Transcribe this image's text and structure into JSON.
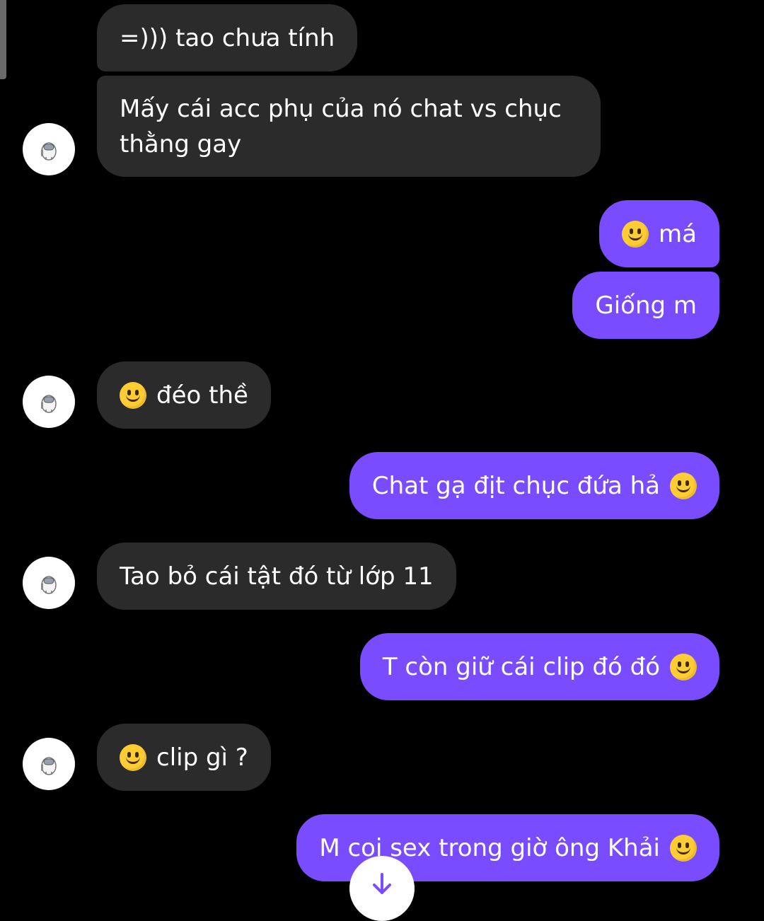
{
  "messages": [
    {
      "from": "them",
      "text": "=))) tao chưa tính"
    },
    {
      "from": "them",
      "text": "Mấy cái acc phụ của nó chat vs chục thằng gay"
    },
    {
      "from": "me",
      "emoji": "slightly-smiling-face",
      "text": "má"
    },
    {
      "from": "me",
      "text": "Giống m"
    },
    {
      "from": "them",
      "emoji": "slightly-smiling-face",
      "text": "đéo thề"
    },
    {
      "from": "me",
      "text": "Chat gạ địt chục đứa hả",
      "emoji": "slightly-smiling-face"
    },
    {
      "from": "them",
      "text": "Tao bỏ cái tật đó từ lớp 11"
    },
    {
      "from": "me",
      "text": "T còn giữ cái clip đó đó",
      "emoji": "slightly-smiling-face"
    },
    {
      "from": "them",
      "emoji": "slightly-smiling-face",
      "text": "clip gì ?"
    },
    {
      "from": "me",
      "text": "M coi sex trong giờ ông Khải",
      "emoji": "slightly-smiling-face"
    }
  ],
  "colors": {
    "background": "#000000",
    "incoming_bubble": "#2b2b2b",
    "outgoing_bubble": "#7a4cff",
    "text": "#ffffff"
  },
  "icons": {
    "avatar": "astronaut-avatar-icon",
    "scroll_down": "arrow-down-icon"
  }
}
